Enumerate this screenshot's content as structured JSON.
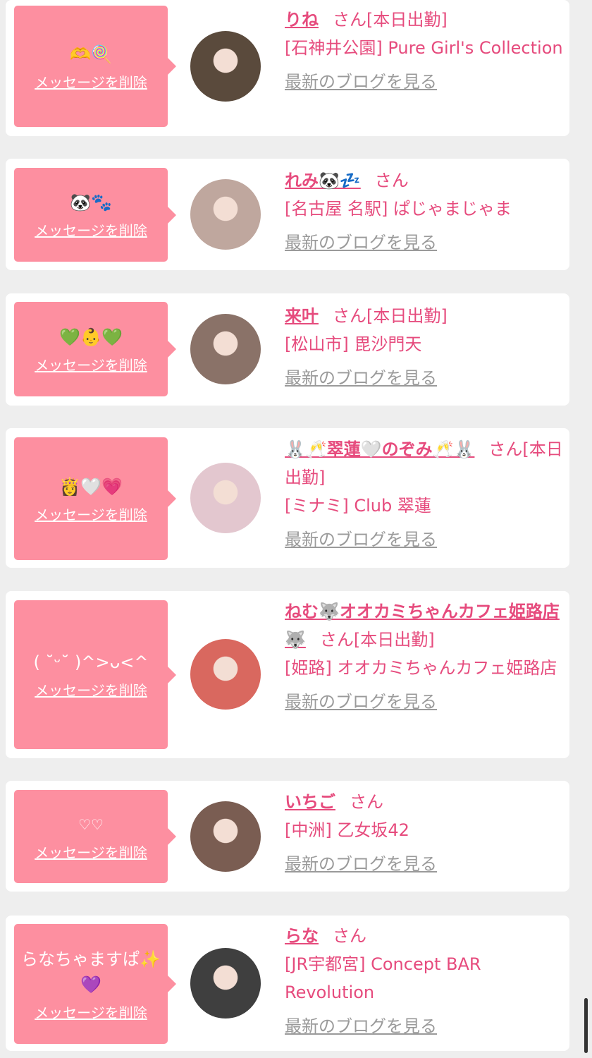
{
  "messages": [
    {
      "message": "🫶🍭",
      "delete_label": "メッセージを削除",
      "name": "りね",
      "honorific": "さん",
      "shift": "[本日出勤]",
      "shop": "[石神井公園] Pure Girl's Collection",
      "blog_label": "最新のブログを見る",
      "avatar_color": "#5a4a3c"
    },
    {
      "message": "🐼🐾",
      "delete_label": "メッセージを削除",
      "name": "れみ🐼💤",
      "honorific": "さん",
      "shift": "",
      "shop": "[名古屋 名駅] ぱじゃまじゃま",
      "blog_label": "最新のブログを見る",
      "avatar_color": "#bfa79e"
    },
    {
      "message": "💚👶💚",
      "delete_label": "メッセージを削除",
      "name": "来叶",
      "honorific": "さん",
      "shift": "[本日出勤]",
      "shop": "[松山市] 毘沙門天",
      "blog_label": "最新のブログを見る",
      "avatar_color": "#8a7268"
    },
    {
      "message": "👸🤍💗",
      "delete_label": "メッセージを削除",
      "name": "🐰🥂翠蓮🤍のぞみ🥂🐰",
      "honorific": "さん",
      "shift": "[本日出勤]",
      "shop": "[ミナミ] Club 翠蓮",
      "blog_label": "最新のブログを見る",
      "avatar_color": "#e3c7cf"
    },
    {
      "message": "( ˘ᵕ˘ )^>ᴗ<^",
      "delete_label": "メッセージを削除",
      "name": "ねむ🐺オオカミちゃんカフェ姫路店🐺",
      "honorific": "さん",
      "shift": "[本日出勤]",
      "shop": "[姫路] オオカミちゃんカフェ姫路店",
      "blog_label": "最新のブログを見る",
      "avatar_color": "#d9685f"
    },
    {
      "message": "♡♡",
      "delete_label": "メッセージを削除",
      "name": "いちご",
      "honorific": "さん",
      "shift": "",
      "shop": "[中洲] 乙女坂42",
      "blog_label": "最新のブログを見る",
      "avatar_color": "#7a5d52"
    },
    {
      "message": "らなちゃますぱ✨💜",
      "delete_label": "メッセージを削除",
      "name": "らな",
      "honorific": "さん",
      "shift": "",
      "shop": "[JR宇都宮] Concept BAR Revolution",
      "blog_label": "最新のブログを見る",
      "avatar_color": "#3f3f3f"
    }
  ]
}
